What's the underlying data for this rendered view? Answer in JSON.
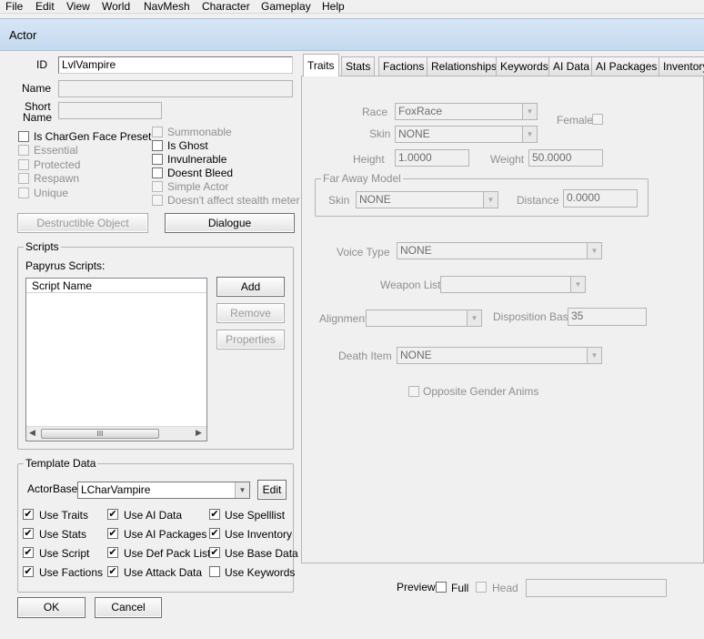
{
  "menu": [
    "File",
    "Edit",
    "View",
    "World",
    "NavMesh",
    "Character",
    "Gameplay",
    "Help"
  ],
  "window": {
    "title": "Actor"
  },
  "identity": {
    "id_label": "ID",
    "id_value": "LvlVampire",
    "name_label": "Name",
    "name_value": "",
    "short_name_label_1": "Short",
    "short_name_label_2": "Name",
    "short_name_value": ""
  },
  "flags": {
    "left": [
      {
        "label": "Is CharGen Face Preset",
        "checked": false,
        "enabled": true
      },
      {
        "label": "Essential",
        "checked": false,
        "enabled": false
      },
      {
        "label": "Protected",
        "checked": false,
        "enabled": false
      },
      {
        "label": "Respawn",
        "checked": false,
        "enabled": false
      },
      {
        "label": "Unique",
        "checked": false,
        "enabled": false
      }
    ],
    "right": [
      {
        "label": "Summonable",
        "checked": false,
        "enabled": false
      },
      {
        "label": "Is Ghost",
        "checked": false,
        "enabled": true
      },
      {
        "label": "Invulnerable",
        "checked": false,
        "enabled": true
      },
      {
        "label": "Doesnt Bleed",
        "checked": false,
        "enabled": true
      },
      {
        "label": "Simple Actor",
        "checked": false,
        "enabled": false
      },
      {
        "label": "Doesn't affect stealth meter",
        "checked": false,
        "enabled": false
      }
    ]
  },
  "buttons": {
    "destructible": "Destructible Object",
    "dialogue": "Dialogue",
    "ok": "OK",
    "cancel": "Cancel"
  },
  "scripts": {
    "group_label": "Scripts",
    "papyrus_label": "Papyrus Scripts:",
    "column_header": "Script Name",
    "scroll_grip": "III",
    "add": "Add",
    "remove": "Remove",
    "properties": "Properties"
  },
  "template": {
    "group_label": "Template Data",
    "actorbase_label": "ActorBase",
    "actorbase_value": "LCharVampire",
    "edit": "Edit",
    "options": [
      {
        "label": "Use Traits",
        "checked": true
      },
      {
        "label": "Use AI Data",
        "checked": true
      },
      {
        "label": "Use Spelllist",
        "checked": true
      },
      {
        "label": "Use Stats",
        "checked": true
      },
      {
        "label": "Use AI Packages",
        "checked": true
      },
      {
        "label": "Use Inventory",
        "checked": true
      },
      {
        "label": "Use Script",
        "checked": true
      },
      {
        "label": "Use Def Pack List",
        "checked": true
      },
      {
        "label": "Use Base Data",
        "checked": true
      },
      {
        "label": "Use Factions",
        "checked": true
      },
      {
        "label": "Use Attack Data",
        "checked": true
      },
      {
        "label": "Use Keywords",
        "checked": false
      }
    ]
  },
  "tabs": [
    "Traits",
    "Stats",
    "Factions",
    "Relationships",
    "Keywords",
    "AI Data",
    "AI Packages",
    "Inventory"
  ],
  "active_tab": "Traits",
  "traits": {
    "race_label": "Race",
    "race_value": "FoxRace",
    "female_label": "Female",
    "skin_label": "Skin",
    "skin_value": "NONE",
    "height_label": "Height",
    "height_value": "1.0000",
    "weight_label": "Weight",
    "weight_value": "50.0000",
    "far_away_label": "Far Away Model",
    "far_skin_label": "Skin",
    "far_skin_value": "NONE",
    "distance_label": "Distance",
    "distance_value": "0.0000",
    "voice_label": "Voice Type",
    "voice_value": "NONE",
    "weapon_list_label": "Weapon List",
    "weapon_list_value": "",
    "alignment_label": "Alignment",
    "alignment_value": "",
    "disposition_label": "Disposition Base",
    "disposition_value": "35",
    "death_item_label": "Death Item",
    "death_item_value": "NONE",
    "opposite_gender_label": "Opposite Gender Anims"
  },
  "preview": {
    "label": "Preview",
    "full_label": "Full",
    "head_label": "Head"
  },
  "colors": {
    "window_bg": "#f0f0f0",
    "titlebar": "#c8dcf0",
    "disabled_text": "#8f8f8f"
  }
}
